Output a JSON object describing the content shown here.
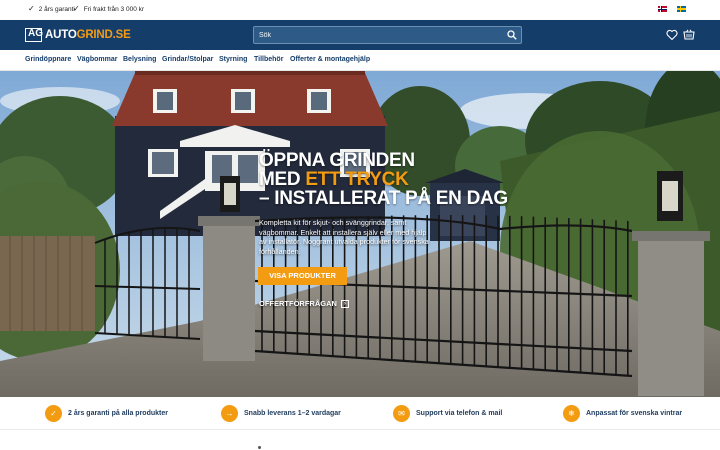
{
  "topbar": {
    "usps": [
      "2 års garanti",
      "Fri frakt från 3 000 kr"
    ],
    "flags": [
      "norway-flag-icon",
      "sweden-flag-icon"
    ]
  },
  "header": {
    "logo_part1": "AUTO",
    "logo_part2": "GRIND.SE",
    "logo_mark": "AG",
    "search_placeholder": "Sök"
  },
  "nav": {
    "items": [
      "Grindöppnare",
      "Vägbommar",
      "Belysning",
      "Grindar/Stolpar",
      "Styrning",
      "Tillbehör",
      "Offerter & montagehjälp"
    ]
  },
  "hero": {
    "title_line1": "Öppna grinden",
    "title_line2_a": "med ",
    "title_line2_b": "ett tryck",
    "title_line3": "– installerat på en dag",
    "description": "Kompletta kit för skjut- och svänggrindar, samt vägbommar. Enkelt att installera själv eller med hjälp av installatör. Noggrant utvalda produkter för svenska förhållanden.",
    "cta": "Visa produkter",
    "secondary_link": "Offertförfrågan"
  },
  "usp_bar": [
    {
      "icon": "check-icon",
      "symbol": "✓",
      "label": "2 års garanti på alla produkter"
    },
    {
      "icon": "arrow-icon",
      "symbol": "→",
      "label": "Snabb leverans 1–2 vardagar"
    },
    {
      "icon": "mail-icon",
      "symbol": "✉",
      "label": "Support via telefon & mail"
    },
    {
      "icon": "snowflake-icon",
      "symbol": "❄",
      "label": "Anpassat för svenska vintrar"
    }
  ],
  "colors": {
    "brand": "#153d6a",
    "accent": "#f39c12"
  }
}
